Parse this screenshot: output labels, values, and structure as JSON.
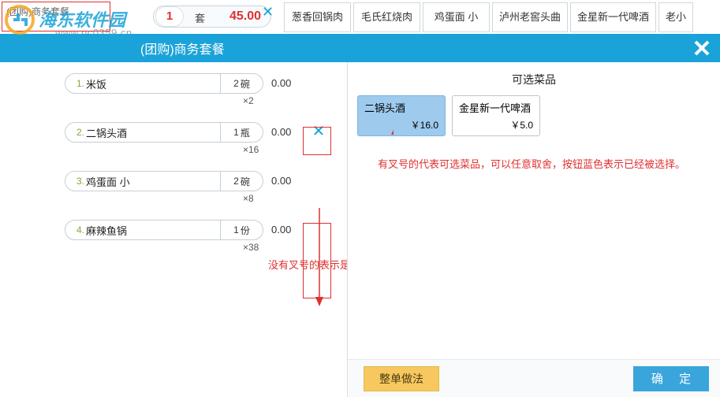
{
  "watermark": {
    "url": "www.pc0359.cn"
  },
  "top": {
    "box_label": "(团购)商务套餐",
    "qty": "1",
    "unit": "套",
    "price": "45.00",
    "tabs": [
      "葱香回锅肉",
      "毛氏红烧肉",
      "鸡蛋面 小",
      "泸州老窖头曲",
      "金星新一代啤酒",
      "老小"
    ]
  },
  "titlebar": {
    "text": "(团购)商务套餐"
  },
  "rows": [
    {
      "num": "1.",
      "name": "米饭",
      "qnum": "2",
      "qunit": "碗",
      "price": "0.00",
      "mult": "×2",
      "removable": false
    },
    {
      "num": "2.",
      "name": "二锅头酒",
      "qnum": "1",
      "qunit": "瓶",
      "price": "0.00",
      "mult": "×16",
      "removable": true
    },
    {
      "num": "3.",
      "name": "鸡蛋面 小",
      "qnum": "2",
      "qunit": "碗",
      "price": "0.00",
      "mult": "×8",
      "removable": false
    },
    {
      "num": "4.",
      "name": "麻辣鱼锅",
      "qnum": "1",
      "qunit": "份",
      "price": "0.00",
      "mult": "×38",
      "removable": false
    }
  ],
  "right": {
    "title": "可选菜品",
    "options": [
      {
        "name": "二锅头酒",
        "price": "￥16.0",
        "selected": true
      },
      {
        "name": "金星新一代啤酒",
        "price": "￥5.0",
        "selected": false
      }
    ],
    "annot1": "有叉号的代表可选菜品，可以任意取舍，按钮蓝色表示已经被选择。",
    "annot2": "没有叉号的表示是固定菜品",
    "btn_zdzf": "整单做法",
    "btn_ok": "确 定"
  }
}
